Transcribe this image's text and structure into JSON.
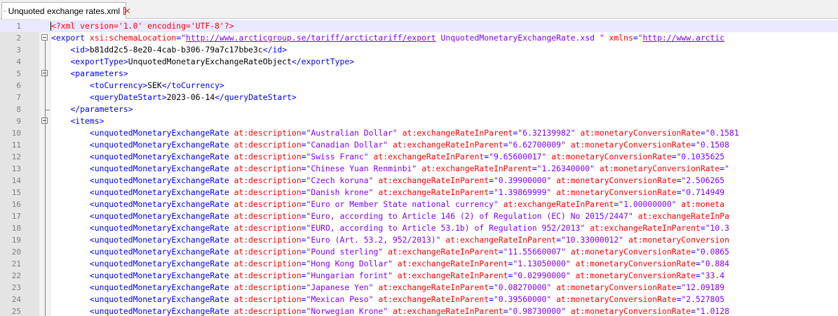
{
  "tab": {
    "label": "Unquoted exchange rates.xml",
    "icon": "save-disk-icon"
  },
  "colors": {
    "tag": "#0000ff",
    "attribute": "#ff0000",
    "value": "#8000ff",
    "text": "#000000",
    "current_line": "#e8e8ff"
  },
  "lines": [
    {
      "n": "1",
      "indent": 0,
      "current": true,
      "tokens": [
        [
          "pi",
          "<?xml version='1.0' encoding='UTF-8'?>"
        ]
      ]
    },
    {
      "n": "2",
      "indent": 0,
      "fold": "open",
      "tokens": [
        [
          "tag",
          "<export "
        ],
        [
          "attr",
          "xsi:schemaLocation"
        ],
        [
          "tag",
          "="
        ],
        [
          "val",
          "\""
        ],
        [
          "url",
          "http://www.arcticgroup.se/tariff/arctictariff/export"
        ],
        [
          "val",
          " UnquotedMonetaryExchangeRate.xsd \""
        ],
        [
          "tag",
          " "
        ],
        [
          "attr",
          "xmlns"
        ],
        [
          "tag",
          "="
        ],
        [
          "val",
          "\""
        ],
        [
          "url",
          "http://www.arctic"
        ]
      ]
    },
    {
      "n": "3",
      "indent": 4,
      "tokens": [
        [
          "tag",
          "<id>"
        ],
        [
          "txt",
          "b81dd2c5-8e20-4cab-b306-79a7c17bbe3c"
        ],
        [
          "tag",
          "</id>"
        ]
      ]
    },
    {
      "n": "4",
      "indent": 4,
      "tokens": [
        [
          "tag",
          "<exportType>"
        ],
        [
          "txt",
          "UnquotedMonetaryExchangeRateObject"
        ],
        [
          "tag",
          "</exportType>"
        ]
      ]
    },
    {
      "n": "5",
      "indent": 4,
      "fold": "open",
      "tokens": [
        [
          "tag",
          "<parameters>"
        ]
      ]
    },
    {
      "n": "6",
      "indent": 8,
      "tokens": [
        [
          "tag",
          "<toCurrency>"
        ],
        [
          "txt",
          "SEK"
        ],
        [
          "tag",
          "</toCurrency>"
        ]
      ]
    },
    {
      "n": "7",
      "indent": 8,
      "tokens": [
        [
          "tag",
          "<queryDateStart>"
        ],
        [
          "txt",
          "2023-06-14"
        ],
        [
          "tag",
          "</queryDateStart>"
        ]
      ]
    },
    {
      "n": "8",
      "indent": 4,
      "fold": "end",
      "tokens": [
        [
          "tag",
          "</parameters>"
        ]
      ]
    },
    {
      "n": "9",
      "indent": 4,
      "fold": "open",
      "tokens": [
        [
          "tag",
          "<items>"
        ]
      ]
    },
    {
      "n": "10",
      "indent": 8,
      "tokens": [
        [
          "tag",
          "<unquotedMonetaryExchangeRate "
        ],
        [
          "attr",
          "at:description"
        ],
        [
          "tag",
          "="
        ],
        [
          "val",
          "\"Australian Dollar\""
        ],
        [
          "tag",
          " "
        ],
        [
          "attr",
          "at:exchangeRateInParent"
        ],
        [
          "tag",
          "="
        ],
        [
          "val",
          "\"6.32139982\""
        ],
        [
          "tag",
          " "
        ],
        [
          "attr",
          "at:monetaryConversionRate"
        ],
        [
          "tag",
          "="
        ],
        [
          "val",
          "\"0.1581"
        ]
      ]
    },
    {
      "n": "11",
      "indent": 8,
      "tokens": [
        [
          "tag",
          "<unquotedMonetaryExchangeRate "
        ],
        [
          "attr",
          "at:description"
        ],
        [
          "tag",
          "="
        ],
        [
          "val",
          "\"Canadian Dollar\""
        ],
        [
          "tag",
          " "
        ],
        [
          "attr",
          "at:exchangeRateInParent"
        ],
        [
          "tag",
          "="
        ],
        [
          "val",
          "\"6.62700009\""
        ],
        [
          "tag",
          " "
        ],
        [
          "attr",
          "at:monetaryConversionRate"
        ],
        [
          "tag",
          "="
        ],
        [
          "val",
          "\"0.1508"
        ]
      ]
    },
    {
      "n": "12",
      "indent": 8,
      "tokens": [
        [
          "tag",
          "<unquotedMonetaryExchangeRate "
        ],
        [
          "attr",
          "at:description"
        ],
        [
          "tag",
          "="
        ],
        [
          "val",
          "\"Swiss Franc\""
        ],
        [
          "tag",
          " "
        ],
        [
          "attr",
          "at:exchangeRateInParent"
        ],
        [
          "tag",
          "="
        ],
        [
          "val",
          "\"9.65600017\""
        ],
        [
          "tag",
          " "
        ],
        [
          "attr",
          "at:monetaryConversionRate"
        ],
        [
          "tag",
          "="
        ],
        [
          "val",
          "\"0.1035625"
        ]
      ]
    },
    {
      "n": "13",
      "indent": 8,
      "tokens": [
        [
          "tag",
          "<unquotedMonetaryExchangeRate "
        ],
        [
          "attr",
          "at:description"
        ],
        [
          "tag",
          "="
        ],
        [
          "val",
          "\"Chinese Yuan Renminbi\""
        ],
        [
          "tag",
          " "
        ],
        [
          "attr",
          "at:exchangeRateInParent"
        ],
        [
          "tag",
          "="
        ],
        [
          "val",
          "\"1.26340000\""
        ],
        [
          "tag",
          " "
        ],
        [
          "attr",
          "at:monetaryConversionRate"
        ],
        [
          "tag",
          "="
        ],
        [
          "val",
          "\""
        ]
      ]
    },
    {
      "n": "14",
      "indent": 8,
      "tokens": [
        [
          "tag",
          "<unquotedMonetaryExchangeRate "
        ],
        [
          "attr",
          "at:description"
        ],
        [
          "tag",
          "="
        ],
        [
          "val",
          "\"Czech koruna\""
        ],
        [
          "tag",
          " "
        ],
        [
          "attr",
          "at:exchangeRateInParent"
        ],
        [
          "tag",
          "="
        ],
        [
          "val",
          "\"0.39900000\""
        ],
        [
          "tag",
          " "
        ],
        [
          "attr",
          "at:monetaryConversionRate"
        ],
        [
          "tag",
          "="
        ],
        [
          "val",
          "\"2.506265"
        ]
      ]
    },
    {
      "n": "15",
      "indent": 8,
      "tokens": [
        [
          "tag",
          "<unquotedMonetaryExchangeRate "
        ],
        [
          "attr",
          "at:description"
        ],
        [
          "tag",
          "="
        ],
        [
          "val",
          "\"Danish krone\""
        ],
        [
          "tag",
          " "
        ],
        [
          "attr",
          "at:exchangeRateInParent"
        ],
        [
          "tag",
          "="
        ],
        [
          "val",
          "\"1.39869999\""
        ],
        [
          "tag",
          " "
        ],
        [
          "attr",
          "at:monetaryConversionRate"
        ],
        [
          "tag",
          "="
        ],
        [
          "val",
          "\"0.714949"
        ]
      ]
    },
    {
      "n": "16",
      "indent": 8,
      "tokens": [
        [
          "tag",
          "<unquotedMonetaryExchangeRate "
        ],
        [
          "attr",
          "at:description"
        ],
        [
          "tag",
          "="
        ],
        [
          "val",
          "\"Euro or Member State national currency\""
        ],
        [
          "tag",
          " "
        ],
        [
          "attr",
          "at:exchangeRateInParent"
        ],
        [
          "tag",
          "="
        ],
        [
          "val",
          "\"1.00000000\""
        ],
        [
          "tag",
          " "
        ],
        [
          "attr",
          "at:moneta"
        ]
      ]
    },
    {
      "n": "17",
      "indent": 8,
      "tokens": [
        [
          "tag",
          "<unquotedMonetaryExchangeRate "
        ],
        [
          "attr",
          "at:description"
        ],
        [
          "tag",
          "="
        ],
        [
          "val",
          "\"Euro, according to Article 146 (2) of Regulation (EC) No 2015/2447\""
        ],
        [
          "tag",
          " "
        ],
        [
          "attr",
          "at:exchangeRateInPa"
        ]
      ]
    },
    {
      "n": "18",
      "indent": 8,
      "tokens": [
        [
          "tag",
          "<unquotedMonetaryExchangeRate "
        ],
        [
          "attr",
          "at:description"
        ],
        [
          "tag",
          "="
        ],
        [
          "val",
          "\"EURO, according to Article 53.1b) of Regulation 952/2013\""
        ],
        [
          "tag",
          " "
        ],
        [
          "attr",
          "at:exchangeRateInParent"
        ],
        [
          "tag",
          "="
        ],
        [
          "val",
          "\"10.3"
        ]
      ]
    },
    {
      "n": "19",
      "indent": 8,
      "tokens": [
        [
          "tag",
          "<unquotedMonetaryExchangeRate "
        ],
        [
          "attr",
          "at:description"
        ],
        [
          "tag",
          "="
        ],
        [
          "val",
          "\"Euro (Art. 53.2, 952/2013)\""
        ],
        [
          "tag",
          " "
        ],
        [
          "attr",
          "at:exchangeRateInParent"
        ],
        [
          "tag",
          "="
        ],
        [
          "val",
          "\"10.33000012\""
        ],
        [
          "tag",
          " "
        ],
        [
          "attr",
          "at:monetaryConversion"
        ]
      ]
    },
    {
      "n": "20",
      "indent": 8,
      "tokens": [
        [
          "tag",
          "<unquotedMonetaryExchangeRate "
        ],
        [
          "attr",
          "at:description"
        ],
        [
          "tag",
          "="
        ],
        [
          "val",
          "\"Pound sterling\""
        ],
        [
          "tag",
          " "
        ],
        [
          "attr",
          "at:exchangeRateInParent"
        ],
        [
          "tag",
          "="
        ],
        [
          "val",
          "\"11.55660007\""
        ],
        [
          "tag",
          " "
        ],
        [
          "attr",
          "at:monetaryConversionRate"
        ],
        [
          "tag",
          "="
        ],
        [
          "val",
          "\"0.0865"
        ]
      ]
    },
    {
      "n": "21",
      "indent": 8,
      "tokens": [
        [
          "tag",
          "<unquotedMonetaryExchangeRate "
        ],
        [
          "attr",
          "at:description"
        ],
        [
          "tag",
          "="
        ],
        [
          "val",
          "\"Hong Kong Dollar\""
        ],
        [
          "tag",
          " "
        ],
        [
          "attr",
          "at:exchangeRateInParent"
        ],
        [
          "tag",
          "="
        ],
        [
          "val",
          "\"1.13050000\""
        ],
        [
          "tag",
          " "
        ],
        [
          "attr",
          "at:monetaryConversionRate"
        ],
        [
          "tag",
          "="
        ],
        [
          "val",
          "\"0.884"
        ]
      ]
    },
    {
      "n": "22",
      "indent": 8,
      "tokens": [
        [
          "tag",
          "<unquotedMonetaryExchangeRate "
        ],
        [
          "attr",
          "at:description"
        ],
        [
          "tag",
          "="
        ],
        [
          "val",
          "\"Hungarian forint\""
        ],
        [
          "tag",
          " "
        ],
        [
          "attr",
          "at:exchangeRateInParent"
        ],
        [
          "tag",
          "="
        ],
        [
          "val",
          "\"0.02990000\""
        ],
        [
          "tag",
          " "
        ],
        [
          "attr",
          "at:monetaryConversionRate"
        ],
        [
          "tag",
          "="
        ],
        [
          "val",
          "\"33.4"
        ]
      ]
    },
    {
      "n": "23",
      "indent": 8,
      "tokens": [
        [
          "tag",
          "<unquotedMonetaryExchangeRate "
        ],
        [
          "attr",
          "at:description"
        ],
        [
          "tag",
          "="
        ],
        [
          "val",
          "\"Japanese Yen\""
        ],
        [
          "tag",
          " "
        ],
        [
          "attr",
          "at:exchangeRateInParent"
        ],
        [
          "tag",
          "="
        ],
        [
          "val",
          "\"0.08270000\""
        ],
        [
          "tag",
          " "
        ],
        [
          "attr",
          "at:monetaryConversionRate"
        ],
        [
          "tag",
          "="
        ],
        [
          "val",
          "\"12.09189"
        ]
      ]
    },
    {
      "n": "24",
      "indent": 8,
      "tokens": [
        [
          "tag",
          "<unquotedMonetaryExchangeRate "
        ],
        [
          "attr",
          "at:description"
        ],
        [
          "tag",
          "="
        ],
        [
          "val",
          "\"Mexican Peso\""
        ],
        [
          "tag",
          " "
        ],
        [
          "attr",
          "at:exchangeRateInParent"
        ],
        [
          "tag",
          "="
        ],
        [
          "val",
          "\"0.39560000\""
        ],
        [
          "tag",
          " "
        ],
        [
          "attr",
          "at:monetaryConversionRate"
        ],
        [
          "tag",
          "="
        ],
        [
          "val",
          "\"2.527805"
        ]
      ]
    },
    {
      "n": "25",
      "indent": 8,
      "tokens": [
        [
          "tag",
          "<unquotedMonetaryExchangeRate "
        ],
        [
          "attr",
          "at:description"
        ],
        [
          "tag",
          "="
        ],
        [
          "val",
          "\"Norwegian Krone\""
        ],
        [
          "tag",
          " "
        ],
        [
          "attr",
          "at:exchangeRateInParent"
        ],
        [
          "tag",
          "="
        ],
        [
          "val",
          "\"0.98730000\""
        ],
        [
          "tag",
          " "
        ],
        [
          "attr",
          "at:monetaryConversionRate"
        ],
        [
          "tag",
          "="
        ],
        [
          "val",
          "\"1.0128"
        ]
      ]
    }
  ]
}
